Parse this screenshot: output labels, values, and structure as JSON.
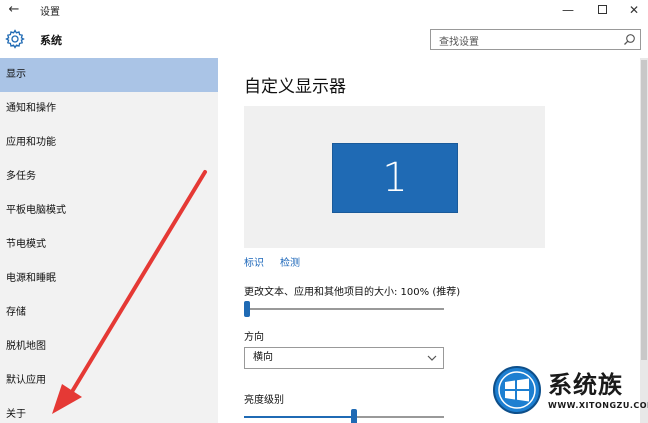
{
  "window": {
    "back_glyph": "←",
    "app_title": "设置",
    "minimize_glyph": "—",
    "close_glyph": "✕"
  },
  "header": {
    "section_title": "系统",
    "search_placeholder": "查找设置"
  },
  "sidebar": {
    "items": [
      {
        "label": "显示",
        "selected": true
      },
      {
        "label": "通知和操作",
        "selected": false
      },
      {
        "label": "应用和功能",
        "selected": false
      },
      {
        "label": "多任务",
        "selected": false
      },
      {
        "label": "平板电脑模式",
        "selected": false
      },
      {
        "label": "节电模式",
        "selected": false
      },
      {
        "label": "电源和睡眠",
        "selected": false
      },
      {
        "label": "存储",
        "selected": false
      },
      {
        "label": "脱机地图",
        "selected": false
      },
      {
        "label": "默认应用",
        "selected": false
      },
      {
        "label": "关于",
        "selected": false
      }
    ]
  },
  "main": {
    "title": "自定义显示器",
    "monitor_number": "1",
    "identify_link": "标识",
    "detect_link": "检测",
    "scale_label": "更改文本、应用和其他项目的大小: 100% (推荐)",
    "scale_level": 0.0,
    "orientation_label": "方向",
    "orientation_value": "横向",
    "brightness_label": "亮度级别",
    "brightness_level": 0.55
  },
  "colors": {
    "accent": "#1f6ab4",
    "selection": "#aac4e6",
    "link": "#1b66b9",
    "annotation_arrow": "#e53935"
  },
  "watermark": {
    "brand": "系统族",
    "url": "WWW.XITONGZU.COM"
  }
}
